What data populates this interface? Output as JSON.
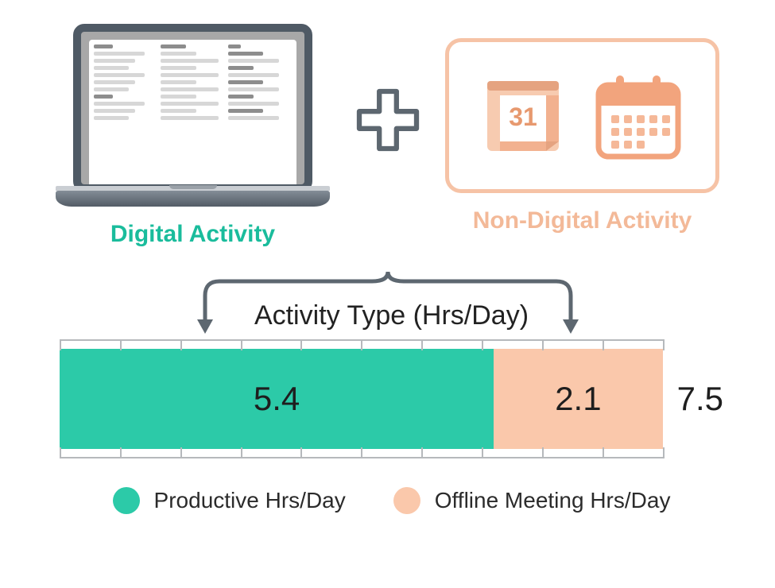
{
  "sections": {
    "digital": {
      "label": "Digital Activity"
    },
    "non_digital": {
      "label": "Non-Digital Activity"
    },
    "calendar_day": "31"
  },
  "chart_data": {
    "type": "bar",
    "orientation": "horizontal_stacked",
    "title": "Activity Type (Hrs/Day)",
    "series": [
      {
        "name": "Productive Hrs/Day",
        "value": 5.4,
        "color": "#2ccaa8"
      },
      {
        "name": "Offline Meeting Hrs/Day",
        "value": 2.1,
        "color": "#fac8ab"
      }
    ],
    "total": 7.5,
    "ticks": 10,
    "xrange": [
      0,
      7.5
    ]
  },
  "legend": {
    "productive": "Productive Hrs/Day",
    "offline": "Offline Meeting Hrs/Day"
  }
}
